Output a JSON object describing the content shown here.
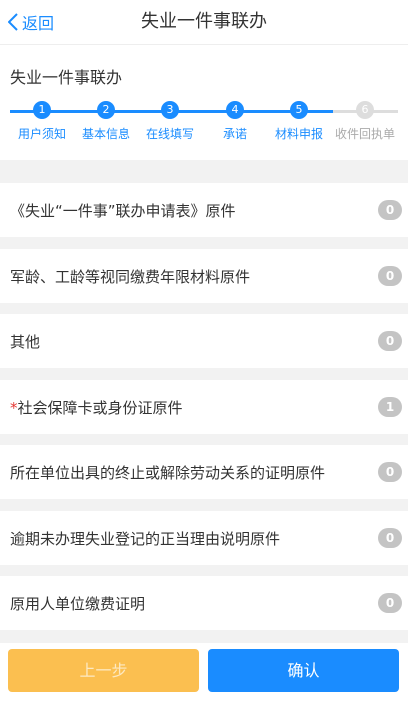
{
  "navbar": {
    "back_label": "返回",
    "title": "失业一件事联办"
  },
  "section_title": "失业一件事联办",
  "stepper": {
    "current_step": 5,
    "steps": [
      {
        "number": "1",
        "label": "用户须知"
      },
      {
        "number": "2",
        "label": "基本信息"
      },
      {
        "number": "3",
        "label": "在线填写"
      },
      {
        "number": "4",
        "label": "承诺"
      },
      {
        "number": "5",
        "label": "材料申报"
      },
      {
        "number": "6",
        "label": "收件回执单"
      }
    ]
  },
  "materials": [
    {
      "required_mark": "",
      "name": "《失业“一件事”联办申请表》原件",
      "count": "0"
    },
    {
      "required_mark": "",
      "name": "军龄、工龄等视同缴费年限材料原件",
      "count": "0"
    },
    {
      "required_mark": "",
      "name": "其他",
      "count": "0"
    },
    {
      "required_mark": "*",
      "name": "社会保障卡或身份证原件",
      "count": "1"
    },
    {
      "required_mark": "",
      "name": "所在单位出具的终止或解除劳动关系的证明原件",
      "count": "0"
    },
    {
      "required_mark": "",
      "name": "逾期未办理失业登记的正当理由说明原件",
      "count": "0"
    },
    {
      "required_mark": "",
      "name": "原用人单位缴费证明",
      "count": "0"
    }
  ],
  "footer": {
    "prev_label": "上一步",
    "confirm_label": "确认"
  },
  "colors": {
    "accent": "#1a8cff",
    "prev_button": "#fbbf50",
    "badge": "#c4c4c4",
    "required": "#e53935"
  }
}
